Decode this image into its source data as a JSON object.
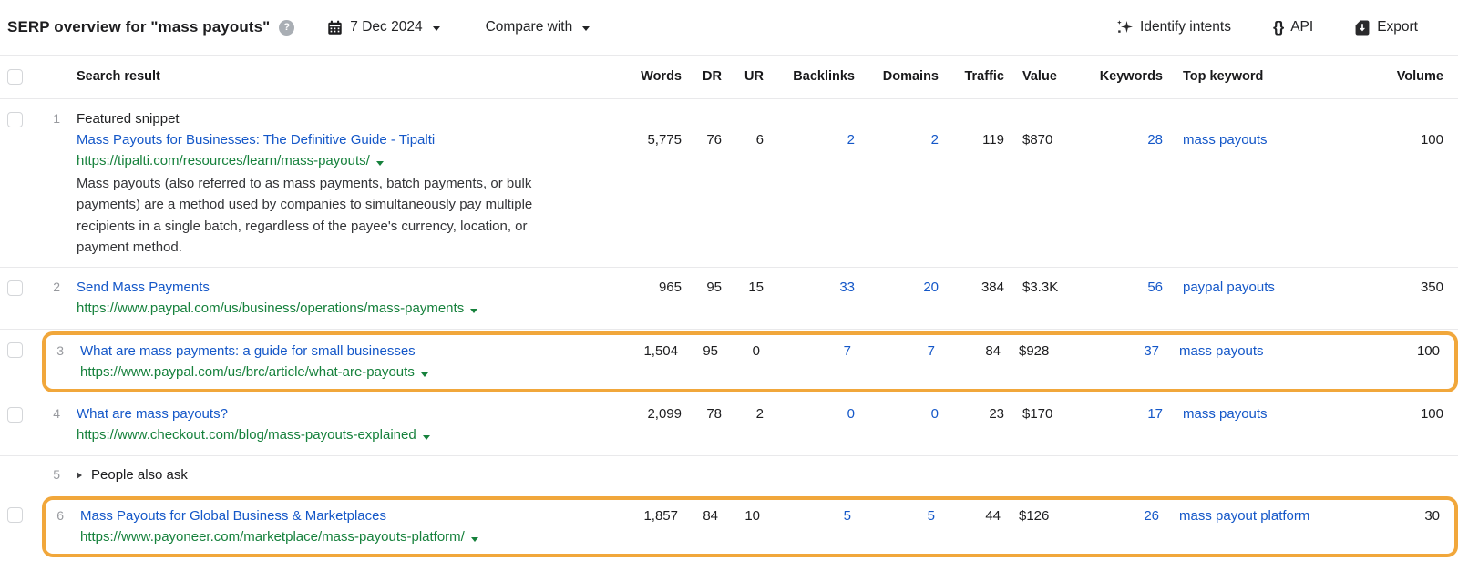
{
  "toolbar": {
    "title": "SERP overview for \"mass payouts\"",
    "help_glyph": "?",
    "date_label": "7 Dec 2024",
    "compare_label": "Compare with",
    "actions": {
      "identify_intents_label": "Identify intents",
      "api_icon_glyph": "{}",
      "api_label": "API",
      "export_label": "Export"
    }
  },
  "colors": {
    "highlight-orange": "#F1A73B",
    "link-blue": "#1457C8",
    "url-green": "#16813C"
  },
  "table": {
    "columns": {
      "search_result": "Search result",
      "words": "Words",
      "dr": "DR",
      "ur": "UR",
      "backlinks": "Backlinks",
      "domains": "Domains",
      "traffic": "Traffic",
      "value": "Value",
      "keywords": "Keywords",
      "top_keyword": "Top keyword",
      "volume": "Volume"
    },
    "rows": [
      {
        "position": "1",
        "badge": "Featured snippet",
        "title": "Mass Payouts for Businesses: The Definitive Guide - Tipalti",
        "url": "https://tipalti.com/resources/learn/mass-payouts/",
        "description": "Mass payouts (also referred to as mass payments, batch payments, or bulk payments) are a method used by companies to simultaneously pay multiple recipients in a single batch, regardless of the payee's currency, location, or payment method.",
        "words": "5,775",
        "dr": "76",
        "ur": "6",
        "backlinks": "2",
        "domains": "2",
        "traffic": "119",
        "value": "$870",
        "keywords": "28",
        "top_keyword": "mass payouts",
        "volume": "100"
      },
      {
        "position": "2",
        "title": "Send Mass Payments",
        "url": "https://www.paypal.com/us/business/operations/mass-payments",
        "words": "965",
        "dr": "95",
        "ur": "15",
        "backlinks": "33",
        "domains": "20",
        "traffic": "384",
        "value": "$3.3K",
        "keywords": "56",
        "top_keyword": "paypal payouts",
        "volume": "350"
      },
      {
        "position": "3",
        "highlighted": true,
        "title": "What are mass payments: a guide for small businesses",
        "url": "https://www.paypal.com/us/brc/article/what-are-payouts",
        "words": "1,504",
        "dr": "95",
        "ur": "0",
        "backlinks": "7",
        "domains": "7",
        "traffic": "84",
        "value": "$928",
        "keywords": "37",
        "top_keyword": "mass payouts",
        "volume": "100"
      },
      {
        "position": "4",
        "title": "What are mass payouts?",
        "url": "https://www.checkout.com/blog/mass-payouts-explained",
        "words": "2,099",
        "dr": "78",
        "ur": "2",
        "backlinks": "0",
        "domains": "0",
        "traffic": "23",
        "value": "$170",
        "keywords": "17",
        "top_keyword": "mass payouts",
        "volume": "100"
      },
      {
        "position": "5",
        "type": "people_also_ask",
        "label": "People also ask"
      },
      {
        "position": "6",
        "highlighted": true,
        "title": "Mass Payouts for Global Business & Marketplaces",
        "url": "https://www.payoneer.com/marketplace/mass-payouts-platform/",
        "words": "1,857",
        "dr": "84",
        "ur": "10",
        "backlinks": "5",
        "domains": "5",
        "traffic": "44",
        "value": "$126",
        "keywords": "26",
        "top_keyword": "mass payout platform",
        "volume": "30"
      }
    ]
  }
}
